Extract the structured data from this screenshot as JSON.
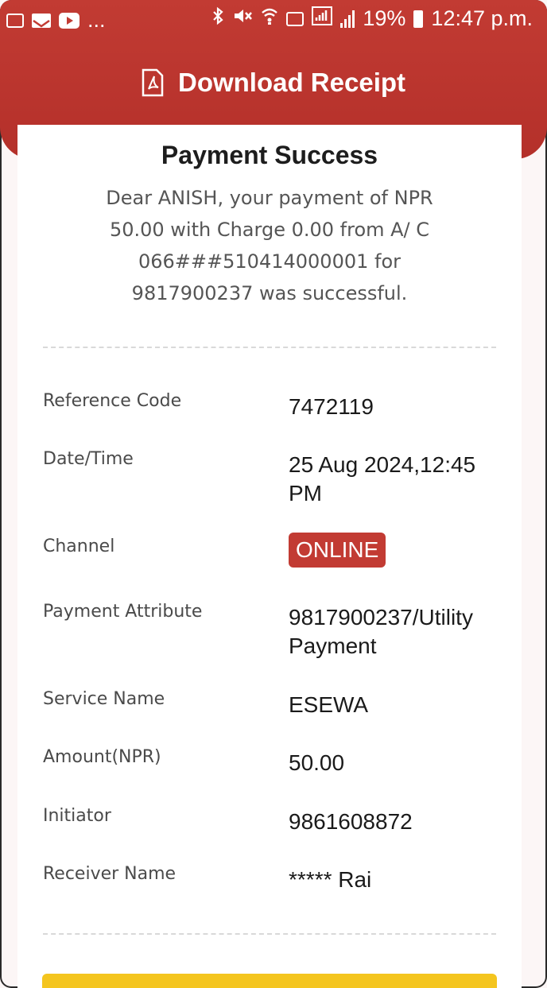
{
  "status_bar": {
    "left_more": "...",
    "battery": "19%",
    "time": "12:47 p.m."
  },
  "header": {
    "title": "Download Receipt"
  },
  "receipt": {
    "title": "Payment Success",
    "message": "Dear ANISH, your payment of NPR 50.00 with Charge 0.00 from A/ C 066###510414000001 for 9817900237 was successful.",
    "rows": [
      {
        "label": "Reference Code",
        "value": "7472119"
      },
      {
        "label": "Date/Time",
        "value": "25 Aug 2024,12:45 PM"
      },
      {
        "label": "Channel",
        "value": "ONLINE"
      },
      {
        "label": "Payment Attribute",
        "value": "9817900237/Utility Payment"
      },
      {
        "label": "Service Name",
        "value": "ESEWA"
      },
      {
        "label": "Amount(NPR)",
        "value": "50.00"
      },
      {
        "label": "Initiator",
        "value": "9861608872"
      },
      {
        "label": "Receiver Name",
        "value": "***** Rai"
      }
    ]
  },
  "colors": {
    "header_red": "#c23b33",
    "badge_red": "#c23b33",
    "button_yellow": "#f4c51f"
  }
}
